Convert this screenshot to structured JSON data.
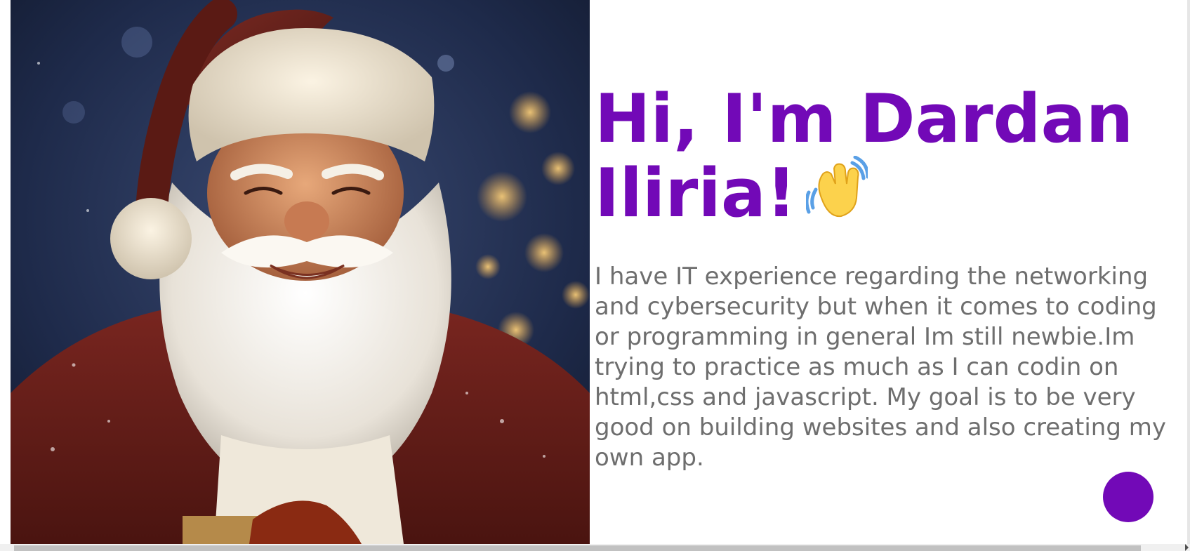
{
  "hero": {
    "image_alt": "Santa Claus portrait"
  },
  "intro": {
    "headline": "Hi, I'm Dardan Iliria!",
    "wave_icon": "waving-hand-icon",
    "bio": "I have IT experience regarding the networking and cybersecurity but when it comes to coding or programming in general Im still newbie.Im trying to practice as much as I can codin on html,css and javascript. My goal is to be very good on building websites and also creating my own app."
  },
  "colors": {
    "accent": "#7209b7",
    "body_text": "#6e6e6e",
    "background": "#ffffff"
  }
}
